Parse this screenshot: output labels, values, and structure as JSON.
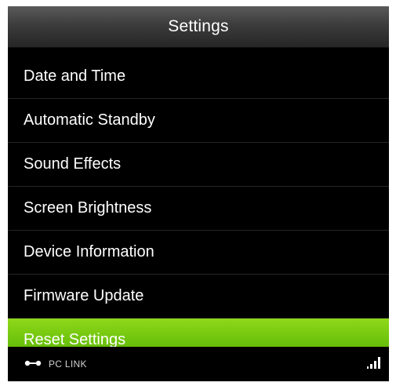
{
  "header": {
    "title": "Settings"
  },
  "menu": {
    "items": [
      {
        "label": "Date and Time"
      },
      {
        "label": "Automatic Standby"
      },
      {
        "label": "Sound Effects"
      },
      {
        "label": "Screen Brightness"
      },
      {
        "label": "Device Information"
      },
      {
        "label": "Firmware Update"
      },
      {
        "label": "Reset Settings"
      }
    ],
    "selected_label": "Reset Settings"
  },
  "status_bar": {
    "connection_label": "PC LINK",
    "connection_icon": "link-icon",
    "signal_icon": "signal-icon"
  },
  "colors": {
    "selected_green": "#7ccc12",
    "background": "#000000",
    "text": "#ffffff"
  }
}
